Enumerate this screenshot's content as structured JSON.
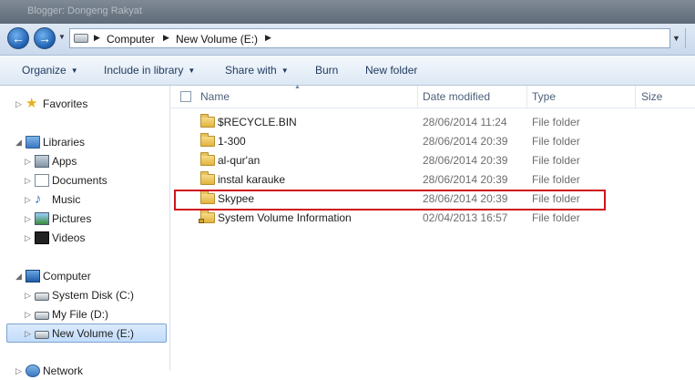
{
  "window": {
    "title": "Blogger: Dongeng Rakyat"
  },
  "address_bar": {
    "crumbs": [
      "Computer",
      "New Volume (E:)"
    ]
  },
  "toolbar": {
    "organize": "Organize",
    "include_in_library": "Include in library",
    "share_with": "Share with",
    "burn": "Burn",
    "new_folder": "New folder"
  },
  "nav": {
    "favorites": "Favorites",
    "libraries": "Libraries",
    "apps": "Apps",
    "documents": "Documents",
    "music": "Music",
    "pictures": "Pictures",
    "videos": "Videos",
    "computer": "Computer",
    "system_disk": "System Disk (C:)",
    "my_file": "My File (D:)",
    "new_volume": "New Volume (E:)",
    "network": "Network"
  },
  "columns": {
    "name": "Name",
    "date_modified": "Date modified",
    "type": "Type",
    "size": "Size"
  },
  "files": [
    {
      "name": "$RECYCLE.BIN",
      "date": "28/06/2014 11:24",
      "type": "File folder"
    },
    {
      "name": "1-300",
      "date": "28/06/2014 20:39",
      "type": "File folder"
    },
    {
      "name": "al-qur'an",
      "date": "28/06/2014 20:39",
      "type": "File folder"
    },
    {
      "name": "instal karauke",
      "date": "28/06/2014 20:39",
      "type": "File folder"
    },
    {
      "name": "Skypee",
      "date": "28/06/2014 20:39",
      "type": "File folder"
    },
    {
      "name": "System Volume Information",
      "date": "02/04/2013 16:57",
      "type": "File folder"
    }
  ],
  "highlight_color": "#d0141e",
  "selected_nav": "New Volume (E:)"
}
